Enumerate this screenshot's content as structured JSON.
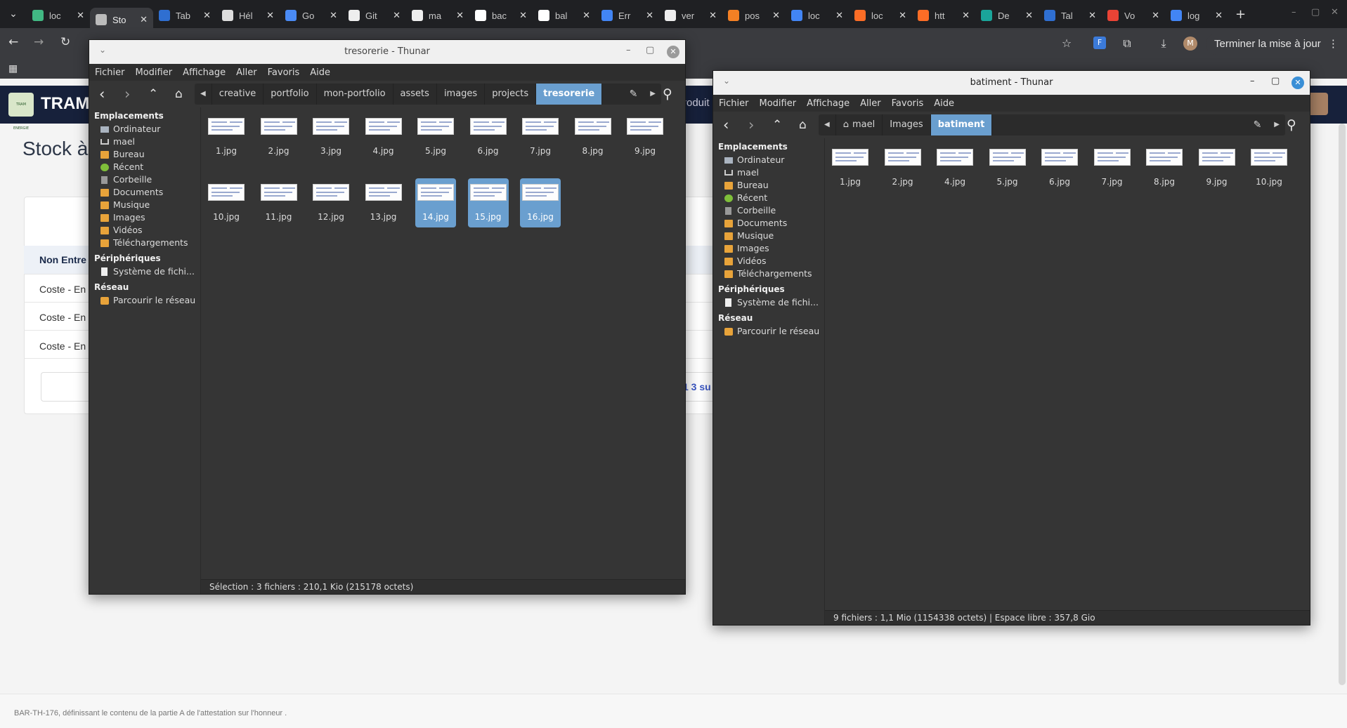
{
  "browser": {
    "tabs": [
      {
        "label": "loc",
        "icon": "vue-icon",
        "color": "#41b883"
      },
      {
        "label": "Sto",
        "icon": "globe-icon",
        "color": "#bbbbbb",
        "active": true
      },
      {
        "label": "Tab",
        "icon": "tableau-icon",
        "color": "#2f6fd1"
      },
      {
        "label": "Hél",
        "icon": "openai-icon",
        "color": "#dddddd"
      },
      {
        "label": "Go",
        "icon": "gemini-icon",
        "color": "#4a8bf5"
      },
      {
        "label": "Git",
        "icon": "github-icon",
        "color": "#eeeeee"
      },
      {
        "label": "ma",
        "icon": "github-icon",
        "color": "#eeeeee"
      },
      {
        "label": "bac",
        "icon": "vercel-icon",
        "color": "#ffffff"
      },
      {
        "label": "bal",
        "icon": "vercel-icon",
        "color": "#ffffff"
      },
      {
        "label": "Err",
        "icon": "google-icon",
        "color": "#4285f4"
      },
      {
        "label": "ver",
        "icon": "github-icon",
        "color": "#eeeeee"
      },
      {
        "label": "pos",
        "icon": "stackoverflow-icon",
        "color": "#f48024"
      },
      {
        "label": "loc",
        "icon": "google-icon",
        "color": "#4285f4"
      },
      {
        "label": "loc",
        "icon": "gitlab-icon",
        "color": "#fc6d26"
      },
      {
        "label": "htt",
        "icon": "gitlab-icon",
        "color": "#fc6d26"
      },
      {
        "label": "De",
        "icon": "diamond-icon",
        "color": "#1aa59a"
      },
      {
        "label": "Tal",
        "icon": "tableau-icon",
        "color": "#2f6fd1"
      },
      {
        "label": "Vo",
        "icon": "gmail-icon",
        "color": "#ea4335"
      },
      {
        "label": "log",
        "icon": "google-icon",
        "color": "#4285f4"
      }
    ],
    "update_label": "Terminer la mise à jour",
    "profile_initial": "M"
  },
  "site": {
    "title": "TRAM",
    "logo_text": "TRAM ENERGIE",
    "nav_fragment": "roduit",
    "heading": "Stock à",
    "table_header": "Non Entre",
    "rows": [
      "Coste - En",
      "Coste - En",
      "Coste - En"
    ],
    "pager_text": "1 3 su",
    "footer": "BAR-TH-176, définissant le contenu de la partie A de l'attestation sur l'honneur ."
  },
  "menus": [
    "Fichier",
    "Modifier",
    "Affichage",
    "Aller",
    "Favoris",
    "Aide"
  ],
  "sidebar": {
    "places_title": "Emplacements",
    "places": [
      {
        "label": "Ordinateur",
        "icon": "computer-icon"
      },
      {
        "label": "mael",
        "icon": "home-icon"
      },
      {
        "label": "Bureau",
        "icon": "folder-icon"
      },
      {
        "label": "Récent",
        "icon": "recent-icon"
      },
      {
        "label": "Corbeille",
        "icon": "trash-icon"
      },
      {
        "label": "Documents",
        "icon": "folder-icon"
      },
      {
        "label": "Musique",
        "icon": "folder-icon"
      },
      {
        "label": "Images",
        "icon": "folder-icon"
      },
      {
        "label": "Vidéos",
        "icon": "folder-icon"
      },
      {
        "label": "Téléchargements",
        "icon": "folder-icon"
      }
    ],
    "devices_title": "Périphériques",
    "devices": [
      {
        "label": "Système de fichi...",
        "icon": "disk-icon"
      }
    ],
    "network_title": "Réseau",
    "network": [
      {
        "label": "Parcourir le réseau",
        "icon": "network-icon"
      }
    ]
  },
  "windows": {
    "tresorerie": {
      "title": "tresorerie - Thunar",
      "crumbs": [
        "creative",
        "portfolio",
        "mon-portfolio",
        "assets",
        "images",
        "projects",
        "tresorerie"
      ],
      "files": [
        {
          "name": "1.jpg"
        },
        {
          "name": "2.jpg"
        },
        {
          "name": "3.jpg"
        },
        {
          "name": "4.jpg"
        },
        {
          "name": "5.jpg"
        },
        {
          "name": "6.jpg"
        },
        {
          "name": "7.jpg"
        },
        {
          "name": "8.jpg"
        },
        {
          "name": "9.jpg"
        },
        {
          "name": "10.jpg"
        },
        {
          "name": "11.jpg"
        },
        {
          "name": "12.jpg"
        },
        {
          "name": "13.jpg"
        },
        {
          "name": "14.jpg",
          "selected": true
        },
        {
          "name": "15.jpg",
          "selected": true
        },
        {
          "name": "16.jpg",
          "selected": true
        }
      ],
      "status": "Sélection : 3 fichiers : 210,1 Kio (215178 octets)"
    },
    "batiment": {
      "title": "batiment - Thunar",
      "crumbs": [
        "mael",
        "Images",
        "batiment"
      ],
      "files": [
        {
          "name": "1.jpg"
        },
        {
          "name": "2.jpg"
        },
        {
          "name": "4.jpg"
        },
        {
          "name": "5.jpg"
        },
        {
          "name": "6.jpg"
        },
        {
          "name": "7.jpg"
        },
        {
          "name": "8.jpg"
        },
        {
          "name": "9.jpg"
        },
        {
          "name": "10.jpg"
        }
      ],
      "status": "9 fichiers : 1,1 Mio (1154338 octets)  |  Espace libre : 357,8 Gio"
    }
  }
}
